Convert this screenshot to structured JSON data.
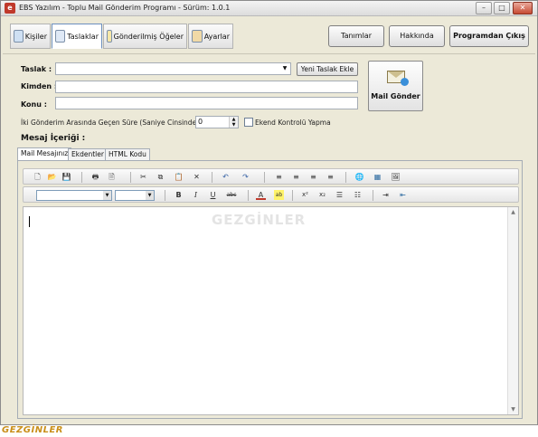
{
  "window": {
    "title": "EBS Yazılım - Toplu Mail Gönderim Programı - Sürüm: 1.0.1"
  },
  "titlebar_buttons": {
    "minimize": "–",
    "maximize": "□",
    "close": "✕"
  },
  "top_tabs": [
    {
      "label": "Kişiler",
      "icon": "contacts-icon"
    },
    {
      "label": "Taslaklar",
      "icon": "drafts-icon",
      "active": true
    },
    {
      "label": "Gönderilmiş Öğeler",
      "icon": "sent-items-icon"
    },
    {
      "label": "Ayarlar",
      "icon": "settings-icon"
    }
  ],
  "top_actions": {
    "tanimlar": "Tanımlar",
    "hakkinda": "Hakkında",
    "cikis": "Programdan Çıkış"
  },
  "form": {
    "taslak_label": "Taslak :",
    "taslak_value": "",
    "yeni_taslak": "Yeni Taslak Ekle",
    "kimden_label": "Kimden :",
    "kimden_value": "",
    "konu_label": "Konu :",
    "konu_value": "",
    "mail_gonder": "Mail Gönder",
    "sure_label": "İki Gönderim Arasında Geçen Süre (Saniye Cinsinden)",
    "sure_value": "0",
    "spin_up": "▲",
    "spin_down": "▼",
    "ekend_label": "Ekend Kontrolü Yapma",
    "mesaj_label": "Mesaj İçeriği :"
  },
  "editor_tabs": [
    {
      "label": "Mail Mesajınız",
      "active": true
    },
    {
      "label": "Ekdentler"
    },
    {
      "label": "HTML Kodu"
    }
  ],
  "toolbar_row1": [
    {
      "name": "new-doc-icon",
      "glyph": "🗋"
    },
    {
      "name": "open-folder-icon",
      "glyph": "📂"
    },
    {
      "name": "save-icon",
      "glyph": "💾"
    },
    {
      "name": "print-icon",
      "glyph": "🖶"
    },
    {
      "name": "print-preview-icon",
      "glyph": "🗎"
    },
    {
      "name": "cut-icon",
      "glyph": "✂"
    },
    {
      "name": "copy-icon",
      "glyph": "⧉"
    },
    {
      "name": "paste-icon",
      "glyph": "📋"
    },
    {
      "name": "delete-icon",
      "glyph": "✕"
    },
    {
      "name": "undo-icon",
      "glyph": "↶"
    },
    {
      "name": "redo-icon",
      "glyph": "↷"
    },
    {
      "name": "align-left-icon",
      "glyph": "≡"
    },
    {
      "name": "align-center-icon",
      "glyph": "≡"
    },
    {
      "name": "align-right-icon",
      "glyph": "≡"
    },
    {
      "name": "justify-icon",
      "glyph": "≡"
    },
    {
      "name": "insert-link-icon",
      "glyph": "🌐"
    },
    {
      "name": "insert-table-icon",
      "glyph": "▦"
    },
    {
      "name": "insert-image-icon",
      "glyph": "🖼"
    }
  ],
  "toolbar_row2": [
    {
      "name": "bold-icon",
      "glyph": "B"
    },
    {
      "name": "italic-icon",
      "glyph": "I"
    },
    {
      "name": "underline-icon",
      "glyph": "U"
    },
    {
      "name": "strikethrough-icon",
      "glyph": "abc"
    },
    {
      "name": "font-color-icon",
      "glyph": "A"
    },
    {
      "name": "highlight-icon",
      "glyph": "ab"
    },
    {
      "name": "superscript-icon",
      "glyph": "x²"
    },
    {
      "name": "subscript-icon",
      "glyph": "x₂"
    },
    {
      "name": "bullet-list-icon",
      "glyph": "☰"
    },
    {
      "name": "numbered-list-icon",
      "glyph": "☷"
    },
    {
      "name": "indent-icon",
      "glyph": "⇥"
    },
    {
      "name": "outdent-icon",
      "glyph": "⇤"
    }
  ],
  "font_select": {
    "font": "",
    "size": ""
  },
  "watermark": "GEZGİNLER",
  "corner_watermark": "GEZGİNLER",
  "colors": {
    "accent": "#6c8fbf",
    "titlebar_close": "#c74a33",
    "watermark": "#c98f1a"
  }
}
